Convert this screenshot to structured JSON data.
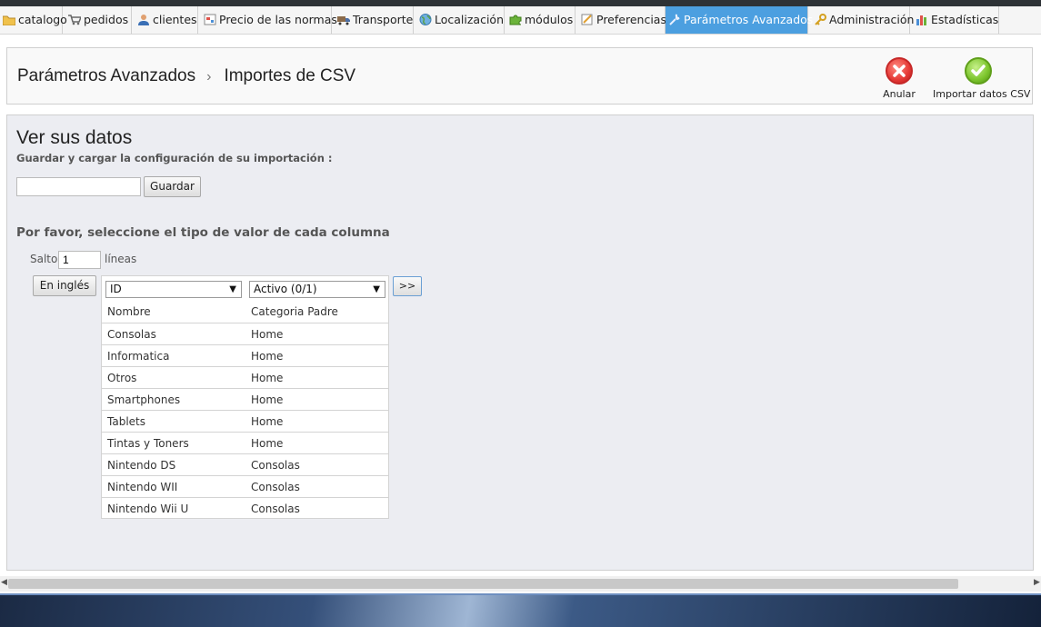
{
  "nav": {
    "tabs": [
      {
        "label": "catalogo",
        "icon": "folder-icon",
        "active": false
      },
      {
        "label": "pedidos",
        "icon": "cart-icon",
        "active": false
      },
      {
        "label": "clientes",
        "icon": "user-icon",
        "active": false
      },
      {
        "label": "Precio de las normas",
        "icon": "price-rules-icon",
        "active": false
      },
      {
        "label": "Transporte",
        "icon": "truck-icon",
        "active": false
      },
      {
        "label": "Localización",
        "icon": "globe-icon",
        "active": false
      },
      {
        "label": "módulos",
        "icon": "puzzle-icon",
        "active": false
      },
      {
        "label": "Preferencias",
        "icon": "preferences-icon",
        "active": false
      },
      {
        "label": "Parámetros Avanzados",
        "icon": "wrench-icon",
        "active": true
      },
      {
        "label": "Administración",
        "icon": "key-icon",
        "active": false
      },
      {
        "label": "Estadísticas",
        "icon": "bar-chart-icon",
        "active": false
      }
    ]
  },
  "header": {
    "breadcrumb_parent": "Parámetros Avanzados",
    "breadcrumb_sep": "›",
    "breadcrumb_current": "Importes de CSV",
    "cancel_label": "Anular",
    "import_label": "Importar datos CSV"
  },
  "main": {
    "title": "Ver sus datos",
    "subtitle": "Guardar y cargar la configuración de su importación :",
    "config_input_value": "",
    "save_label": "Guardar",
    "section_title": "Por favor, seleccione el tipo de valor de cada columna",
    "skip_label": "Salto",
    "skip_value": "1",
    "lines_label": "líneas",
    "english_label": "En inglés",
    "next_label": ">>",
    "column_selects": [
      "ID",
      "Activo (0/1)"
    ],
    "rows": [
      [
        "Nombre",
        "Categoria Padre"
      ],
      [
        "Consolas",
        "Home"
      ],
      [
        "Informatica",
        "Home"
      ],
      [
        "Otros",
        "Home"
      ],
      [
        "Smartphones",
        "Home"
      ],
      [
        "Tablets",
        "Home"
      ],
      [
        "Tintas y Toners",
        "Home"
      ],
      [
        "Nintendo DS",
        "Consolas"
      ],
      [
        "Nintendo WII",
        "Consolas"
      ],
      [
        "Nintendo Wii U",
        "Consolas"
      ]
    ]
  },
  "colors": {
    "active_tab": "#4c9fe0",
    "panel_bg": "#ecedf2",
    "cancel": "#e53935",
    "import": "#7cc52c"
  }
}
